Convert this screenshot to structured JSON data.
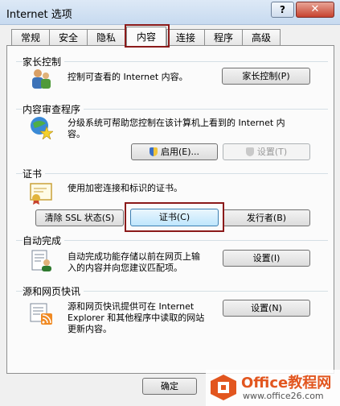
{
  "window": {
    "title": "Internet 选项",
    "help_label": "?",
    "close_label": "✕"
  },
  "tabs": [
    "常规",
    "安全",
    "隐私",
    "内容",
    "连接",
    "程序",
    "高级"
  ],
  "parental": {
    "title": "家长控制",
    "desc": "控制可查看的 Internet 内容。",
    "button": "家长控制(P)"
  },
  "advisor": {
    "title": "内容审查程序",
    "desc1": "分级系统可帮助您控制在该计算机上看到的 Internet 内",
    "desc2": "容。",
    "enable": "启用(E)...",
    "settings": "设置(T)"
  },
  "certs": {
    "title": "证书",
    "desc": "使用加密连接和标识的证书。",
    "clear_ssl": "清除 SSL 状态(S)",
    "certificates": "证书(C)",
    "publishers": "发行者(B)"
  },
  "autocomplete": {
    "title": "自动完成",
    "desc1": "自动完成功能存储以前在网页上输",
    "desc2": "入的内容并向您建议匹配项。",
    "button": "设置(I)"
  },
  "feeds": {
    "title": "源和网页快讯",
    "desc1": "源和网页快讯提供可在 Internet",
    "desc2": "Explorer 和其他程序中读取的网站",
    "desc3": "更新内容。",
    "button": "设置(N)"
  },
  "footer": {
    "ok": "确定"
  },
  "watermark": {
    "brand": "Office教程网",
    "url": "www.office26.com"
  }
}
